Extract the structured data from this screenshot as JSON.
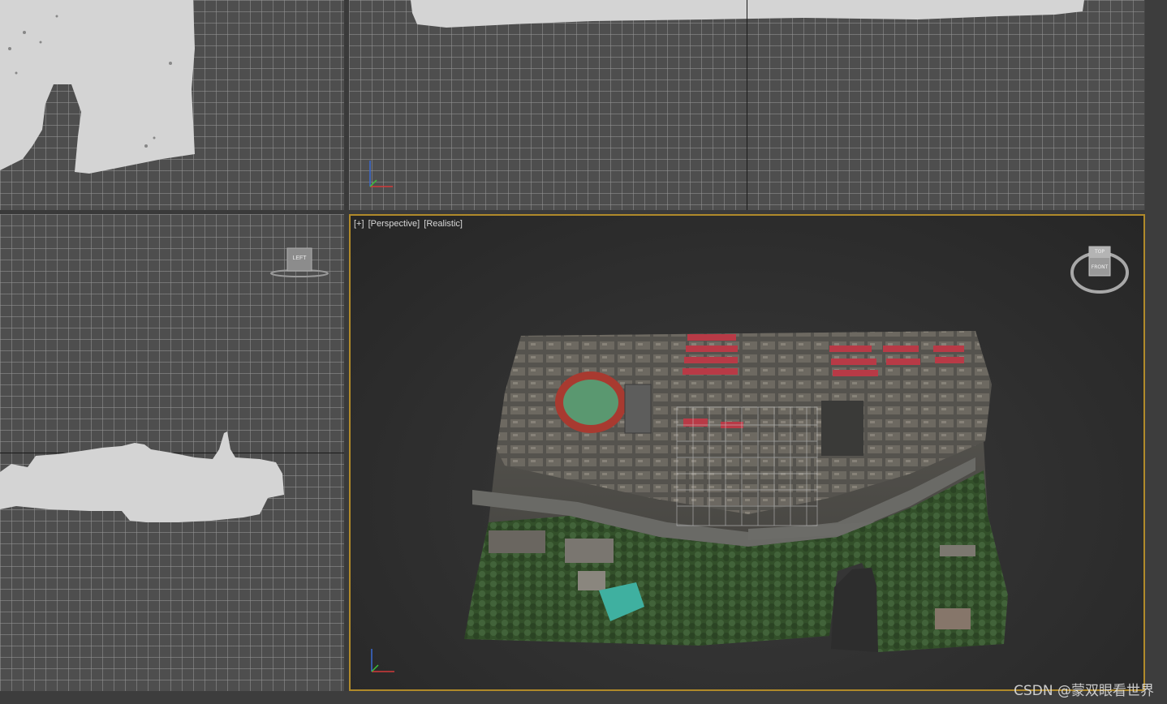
{
  "perspective_viewport": {
    "plus_label": "[+]",
    "view_label": "[Perspective]",
    "shading_label": "[Realistic]",
    "viewcube": {
      "top_label": "TOP",
      "front_label": "FRONT"
    },
    "border_color": "#b08a2a"
  },
  "left_viewport": {
    "viewcube": {
      "label": "LEFT"
    }
  },
  "axis_tripod": {
    "x_color": "#d23a3a",
    "y_color": "#3ac23a",
    "z_color": "#3a6ad2"
  },
  "watermark": "CSDN @蒙双眼看世界"
}
